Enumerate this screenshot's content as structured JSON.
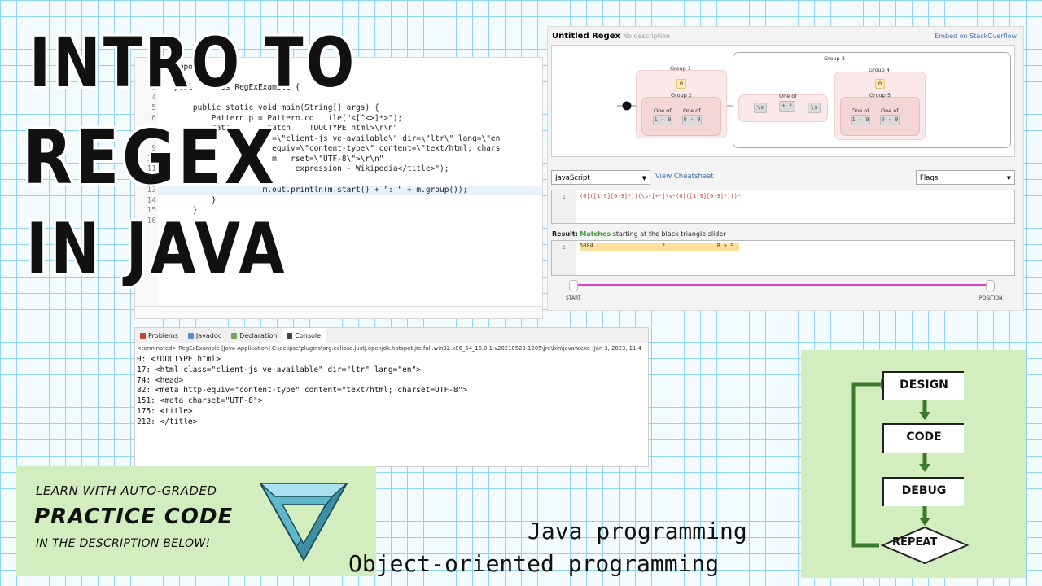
{
  "title": {
    "line1": "INTRO TO",
    "line2": "REGEX",
    "line3": "IN JAVA"
  },
  "editor": {
    "lines": [
      {
        "num": "",
        "text": "impo"
      },
      {
        "num": "3",
        "text": "publ    lass RegExExample {"
      },
      {
        "num": "4",
        "text": ""
      },
      {
        "num": "5",
        "text": "    public static void main(String[] args) {"
      },
      {
        "num": "6",
        "text": "        Pattern p = Pattern.co   ile(\"<[^<>]*>\");"
      },
      {
        "num": "7",
        "text": "        Matc        match    !DOCTYPE html>\\r\\n\""
      },
      {
        "num": "8",
        "text": "                     =\\\"client-js ve-available\\\" dir=\\\"ltr\\\" lang=\\\"en"
      },
      {
        "num": "9",
        "text": "                     equiv=\\\"content-type\\\" content=\\\"text/html; chars"
      },
      {
        "num": "10",
        "text": "                     m   rset=\\\"UTF-8\\\">\\r\\n\""
      },
      {
        "num": "11",
        "text": "                          expression - Wikipedia</title>\");"
      },
      {
        "num": "12",
        "text": ""
      },
      {
        "num": "13",
        "text": "                   m.out.println(m.start() + \": \" + m.group());"
      },
      {
        "num": "14",
        "text": "        }"
      },
      {
        "num": "15",
        "text": "    }"
      },
      {
        "num": "16",
        "text": ""
      }
    ]
  },
  "console": {
    "tabs": [
      "Problems",
      "Javadoc",
      "Declaration",
      "Console"
    ],
    "terminated": "<terminated> RegExExample [Java Application] C:\\eclipse\\plugins\\org.eclipse.justj.openjdk.hotspot.jre.full.win32.x86_64_16.0.1.v20210528-1205\\jre\\bin\\javaw.exe  (Jan 3, 2023, 11:4",
    "output": [
      "0: <!DOCTYPE html>",
      "17: <html class=\"client-js ve-available\" dir=\"ltr\" lang=\"en\">",
      "74: <head>",
      "82: <meta http-equiv=\"content-type\" content=\"text/html; charset=UTF-8\">",
      "151: <meta charset=\"UTF-8\">",
      "175: <title>",
      "212: </title>"
    ]
  },
  "regex": {
    "title": "Untitled Regex",
    "description": "No description",
    "embed": "Embed on StackOverflow",
    "groups": {
      "g1": "Group 1",
      "g2": "Group 2",
      "g3": "Group 3",
      "g4": "Group 4",
      "g5": "Group 5"
    },
    "one_of": "One of",
    "tok_zero": "0",
    "tok_19": "1 - 9",
    "tok_09": "0 - 9",
    "tok_s": "\\s",
    "tok_plus": "+ *",
    "flavor": "JavaScript",
    "cheatsheet": "View Cheatsheet",
    "flags": "Flags",
    "line_no": "1",
    "expression": "(0|([1-9][0-9]*))(\\s*[+*]\\s*(0|([1-9][0-9]*)))*",
    "result_label": "Result:",
    "result_matches": "Matches",
    "result_rest": "starting at the black triangle slider",
    "result_text": "5004                    *               8 + 9",
    "slider_start": "START",
    "slider_pos": "POSITION",
    "accent": "#e040c8"
  },
  "practice": {
    "line1": "LEARN WITH AUTO-GRADED",
    "line2": "PRACTICE CODE",
    "line3": "IN THE DESCRIPTION BELOW!"
  },
  "flow": {
    "design": "DESIGN",
    "code": "CODE",
    "debug": "DEBUG",
    "repeat": "REPEAT"
  },
  "footer": {
    "line1": "Java programming",
    "line2": "Object-oriented programming"
  }
}
